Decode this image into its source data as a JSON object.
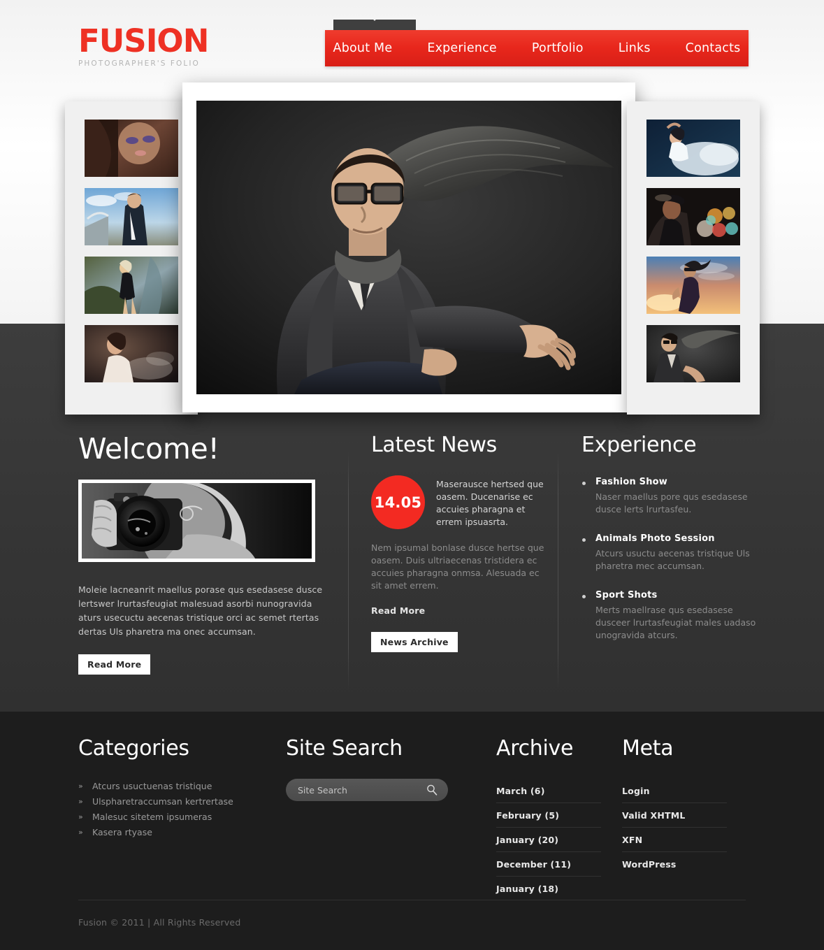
{
  "brand": {
    "logo": "FUSION",
    "tagline": "PHOTOGRAPHER'S FOLIO",
    "accent_color": "#ee3124",
    "nav_bar_color": "#e8271c"
  },
  "nav": {
    "items": [
      {
        "label": "About Me",
        "active": true
      },
      {
        "label": "Experience",
        "active": false
      },
      {
        "label": "Portfolio",
        "active": false
      },
      {
        "label": "Links",
        "active": false
      },
      {
        "label": "Contacts",
        "active": false
      }
    ]
  },
  "gallery": {
    "left_thumbs": [
      {
        "alt": "portrait-woman-purple-eyeshadow"
      },
      {
        "alt": "man-denim-jacket-bridge"
      },
      {
        "alt": "blonde-woman-black-dress-garden"
      },
      {
        "alt": "woman-white-feathers-smoke"
      }
    ],
    "main": {
      "alt": "man-glasses-leather-jacket-flying-fabric"
    },
    "right_thumbs": [
      {
        "alt": "woman-white-tulle-dress-water"
      },
      {
        "alt": "woman-headpiece-bokeh-lights"
      },
      {
        "alt": "woman-sunglasses-sunset-sky"
      },
      {
        "alt": "man-suit-dark-flowing-fabric"
      }
    ]
  },
  "welcome": {
    "heading": "Welcome!",
    "photo_alt": "photographer-holding-camera-bw",
    "body": "Moleie lacneanrit maellus porase qus esedasese dusce lertswer lrurtasfeugiat malesuad asorbi nunogravida aturs usecuctu aecenas tristique orci ac semet rtertas dertas Uls pharetra ma onec accumsan.",
    "button": "Read More"
  },
  "news": {
    "heading": "Latest News",
    "date_badge": "14.05",
    "lead": "Maserausce hertsed que oasem. Ducenarise ec accuies pharagna et errem ipsuasrta.",
    "body": "Nem ipsumal bonlase dusce hertse que oasem. Duis ultriaecenas tristidera ec accuies pharagna onmsa. Alesuada ec sit amet errem.",
    "read_more": "Read More",
    "archive_button": "News Archive"
  },
  "experience": {
    "heading": "Experience",
    "items": [
      {
        "title": "Fashion Show",
        "desc": "Naser maellus pore qus esedasese dusce lerts lrurtasfeu."
      },
      {
        "title": "Animals Photo Session",
        "desc": "Atcurs usuctu aecenas tristique Uls pharetra mec accumsan."
      },
      {
        "title": "Sport Shots",
        "desc": "Merts maellrase qus esedasese dusceer lrurtasfeugiat males uadaso unogravida atcurs."
      }
    ]
  },
  "footer": {
    "categories": {
      "heading": "Categories",
      "items": [
        "Atcurs usuctuenas tristique",
        "Ulspharetraccumsan kertrertase",
        "Malesuc sitetem ipsumeras",
        "Kasera rtyase"
      ]
    },
    "site_search": {
      "heading": "Site Search",
      "placeholder": "Site Search",
      "value": ""
    },
    "archive": {
      "heading": "Archive",
      "items": [
        "March (6)",
        "February (5)",
        "January (20)",
        "December (11)",
        "January  (18)"
      ]
    },
    "meta": {
      "heading": "Meta",
      "items": [
        "Login",
        "Valid XHTML",
        "XFN",
        "WordPress"
      ]
    },
    "copyright": "Fusion © 2011 | All Rights Reserved"
  }
}
